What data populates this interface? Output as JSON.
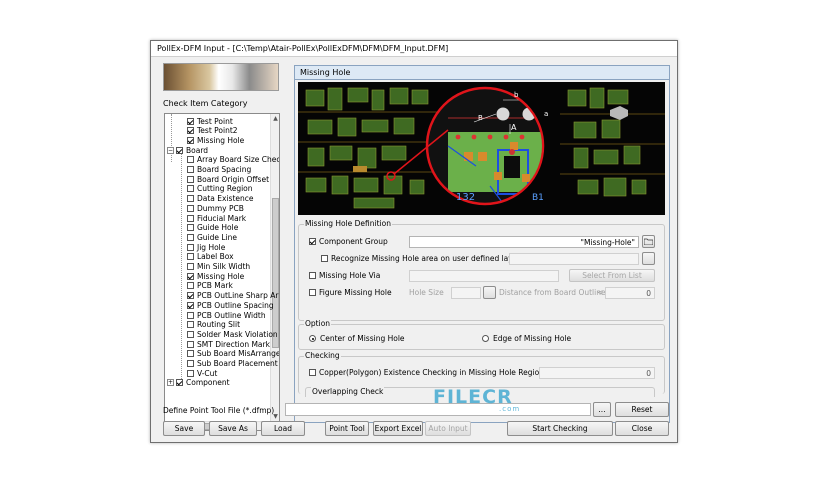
{
  "window": {
    "title": "PollEx-DFM Input - [C:\\Temp\\Atair-PollEx\\PollExDFM\\DFM\\DFM_Input.DFM]"
  },
  "left": {
    "category_label": "Check Item Category",
    "tree": [
      {
        "label": "Test Point",
        "checked": true
      },
      {
        "label": "Test Point2",
        "checked": true
      },
      {
        "label": "Missing Hole",
        "checked": true
      },
      {
        "label": "Board",
        "checked": true,
        "group": true,
        "expand": "−"
      },
      {
        "label": "Array Board Size Chec",
        "checked": false
      },
      {
        "label": "Board Spacing",
        "checked": false
      },
      {
        "label": "Board Origin Offset",
        "checked": false
      },
      {
        "label": "Cutting Region",
        "checked": false
      },
      {
        "label": "Data Existence",
        "checked": false
      },
      {
        "label": "Dummy PCB",
        "checked": false
      },
      {
        "label": "Fiducial Mark",
        "checked": false
      },
      {
        "label": "Guide Hole",
        "checked": false
      },
      {
        "label": "Guide Line",
        "checked": false
      },
      {
        "label": "Jig Hole",
        "checked": false
      },
      {
        "label": "Label Box",
        "checked": false
      },
      {
        "label": "Min Silk Width",
        "checked": false
      },
      {
        "label": "Missing Hole",
        "checked": true
      },
      {
        "label": "PCB Mark",
        "checked": false
      },
      {
        "label": "PCB OutLine Sharp Ar",
        "checked": true
      },
      {
        "label": "PCB Outline Spacing",
        "checked": true
      },
      {
        "label": "PCB Outline Width",
        "checked": false
      },
      {
        "label": "Routing Slit",
        "checked": false
      },
      {
        "label": "Solder Mask Violation",
        "checked": false
      },
      {
        "label": "SMT Direction Mark",
        "checked": false
      },
      {
        "label": "Sub Board MisArrange",
        "checked": false
      },
      {
        "label": "Sub Board Placement",
        "checked": false
      },
      {
        "label": "V-Cut",
        "checked": false
      },
      {
        "label": "Component",
        "checked": true,
        "group": true,
        "expand": "+"
      }
    ]
  },
  "panel": {
    "title": "Missing Hole",
    "image_labels": {
      "b": "b",
      "a": "a",
      "A": "A",
      "B": "B",
      "ref1": "132",
      "ref2": "B1"
    }
  },
  "definition": {
    "title": "Missing Hole Definition",
    "component_group_label": "Component Group",
    "component_group_value": "\"Missing-Hole\"",
    "recognize_label": "Recognize Missing Hole area on user defined layer",
    "via_label": "Missing Hole Via",
    "select_from_list": "Select From List",
    "figure_label": "Figure Missing Hole",
    "hole_size_label": "Hole Size",
    "distance_label": "Distance from Board Outline",
    "distance_unit": "<",
    "distance_value": "0",
    "browse_dots": "..."
  },
  "option": {
    "title": "Option",
    "center_label": "Center of Missing Hole",
    "edge_label": "Edge of Missing Hole"
  },
  "checking": {
    "title": "Checking",
    "copper_label": "Copper(Polygon) Existence Checking in Missing Hole Region",
    "copper_value": "0",
    "overlap_label": "Overlapping Check"
  },
  "footer": {
    "define_label": "Define Point Tool File (*.dfmp)",
    "browse": "...",
    "reset": "Reset",
    "save": "Save",
    "save_as": "Save As",
    "load": "Load",
    "point_tool": "Point Tool",
    "export_excel": "Export Excel",
    "auto_input": "Auto Input",
    "start_checking": "Start Checking",
    "close": "Close"
  },
  "watermark": {
    "text": "FILECR",
    "sub": ".com"
  },
  "colors": {
    "board_green": "#6bb04a",
    "highlight_red": "#e0141a",
    "pad_orange": "#d88a2c",
    "trace_blue": "#1d4fe0"
  }
}
